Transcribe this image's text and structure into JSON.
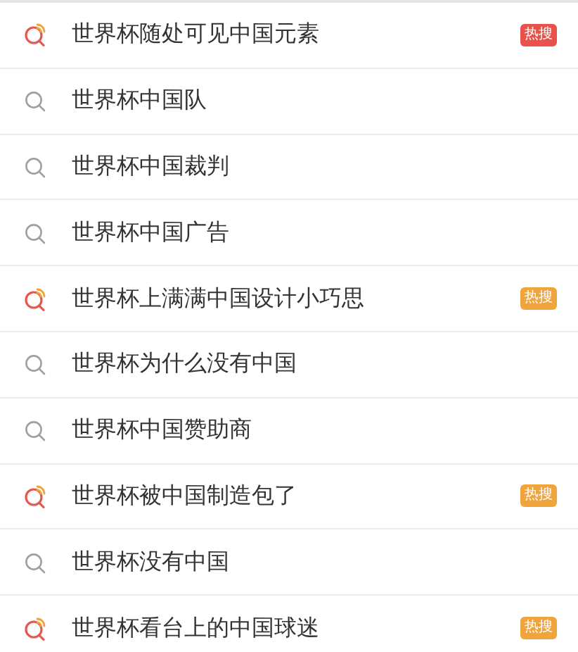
{
  "suggestions": [
    {
      "kind": "hot",
      "text": "世界杯随处可见中国元素",
      "badge": {
        "text": "热搜",
        "color": "#e9524a"
      }
    },
    {
      "kind": "normal",
      "text": "世界杯中国队"
    },
    {
      "kind": "normal",
      "text": "世界杯中国裁判"
    },
    {
      "kind": "normal",
      "text": "世界杯中国广告"
    },
    {
      "kind": "hot",
      "text": "世界杯上满满中国设计小巧思",
      "badge": {
        "text": "热搜",
        "color": "#f0a43c"
      }
    },
    {
      "kind": "normal",
      "text": "世界杯为什么没有中国"
    },
    {
      "kind": "normal",
      "text": "世界杯中国赞助商"
    },
    {
      "kind": "hot",
      "text": "世界杯被中国制造包了",
      "badge": {
        "text": "热搜",
        "color": "#f0a43c"
      }
    },
    {
      "kind": "normal",
      "text": "世界杯没有中国"
    },
    {
      "kind": "hot",
      "text": "世界杯看台上的中国球迷",
      "badge": {
        "text": "热搜",
        "color": "#f0a43c"
      }
    }
  ]
}
